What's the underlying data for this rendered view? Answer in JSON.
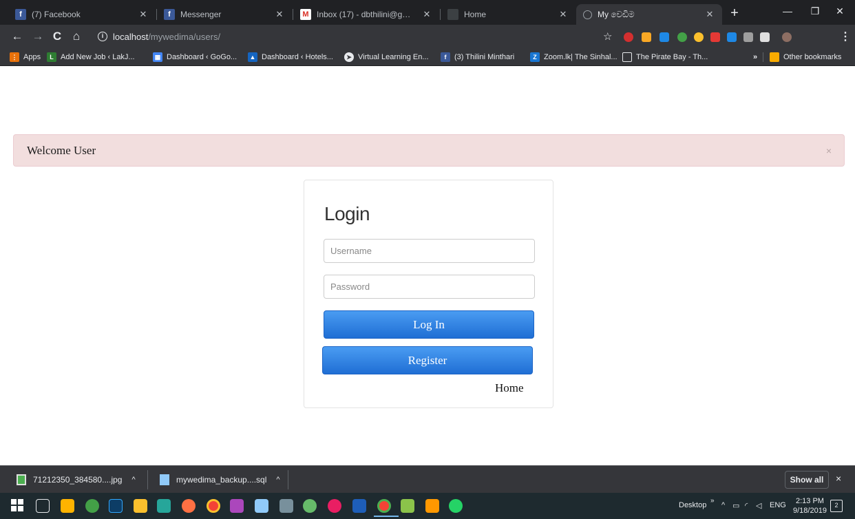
{
  "browser": {
    "tabs": [
      {
        "title": "(7) Facebook",
        "icon": "facebook-icon",
        "color": "#3b5998"
      },
      {
        "title": "Messenger",
        "icon": "facebook-icon",
        "color": "#3b5998"
      },
      {
        "title": "Inbox (17) - dbthilini@gmail.co",
        "icon": "gmail-icon",
        "color": "#d93025"
      },
      {
        "title": "Home",
        "icon": "page-icon",
        "color": "#5f6368"
      },
      {
        "title": "My වෙඩිම",
        "icon": "globe-icon",
        "color": "#5f6368"
      }
    ],
    "url_host": "localhost",
    "url_path": "/mywedima/users/",
    "bookmarks": [
      {
        "label": "Apps",
        "icon": "apps-grid-icon",
        "color": "#e8710a"
      },
      {
        "label": "Add New Job ‹ LakJ...",
        "icon": "lakjobs-icon",
        "color": "#2e7d32"
      },
      {
        "label": "Dashboard ‹ GoGo...",
        "icon": "table-icon",
        "color": "#4285f4"
      },
      {
        "label": "Dashboard ‹ Hotels...",
        "icon": "image-icon",
        "color": "#1565c0"
      },
      {
        "label": "Virtual Learning En...",
        "icon": "circle-icon",
        "color": "#e8eaed"
      },
      {
        "label": "(3) Thilini Minthari",
        "icon": "facebook-icon",
        "color": "#3b5998"
      },
      {
        "label": "Zoom.lk| The Sinhal...",
        "icon": "zoom-icon",
        "color": "#1976d2"
      },
      {
        "label": "The Pirate Bay - Th...",
        "icon": "monitor-icon",
        "color": "#e8eaed"
      }
    ],
    "bookmarks_overflow": "»",
    "other_bookmarks": "Other bookmarks"
  },
  "page": {
    "alert": {
      "message": "Welcome User",
      "close": "×"
    },
    "login": {
      "title": "Login",
      "username_placeholder": "Username",
      "password_placeholder": "Password",
      "login_button": "Log In",
      "register_button": "Register",
      "home_link": "Home"
    }
  },
  "downloads": {
    "items": [
      {
        "name": "71212350_384580....jpg",
        "caret": "^"
      },
      {
        "name": "mywedima_backup....sql",
        "caret": "^"
      }
    ],
    "show_all": "Show all",
    "close": "×"
  },
  "taskbar": {
    "desktop_label": "Desktop",
    "desktop_chevron": "»",
    "language": "ENG",
    "time": "2:13 PM",
    "date": "9/18/2019",
    "notification_count": "2"
  }
}
